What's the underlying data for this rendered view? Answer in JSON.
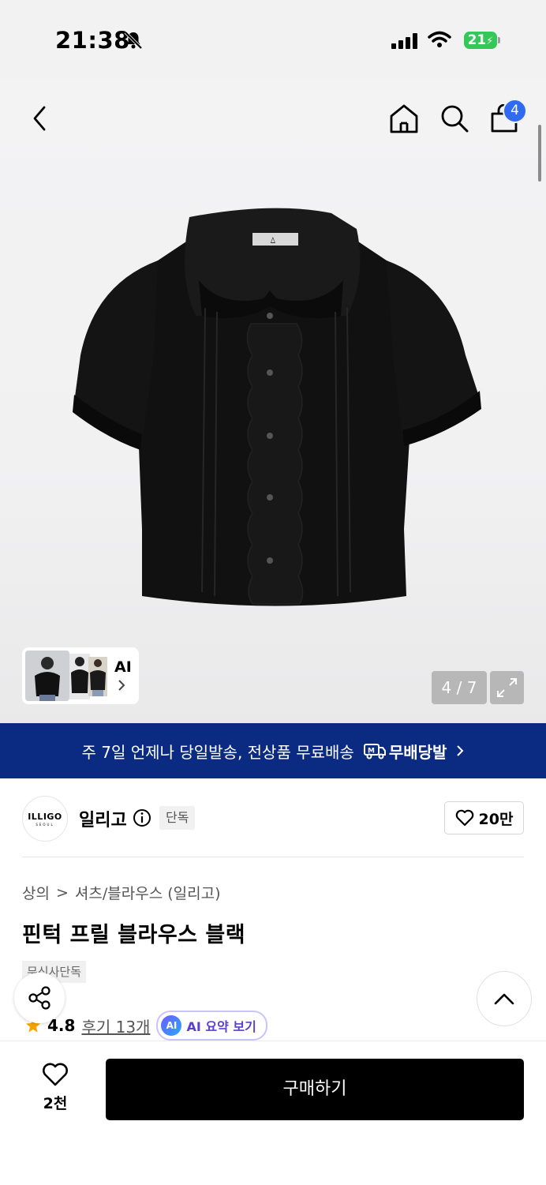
{
  "status_bar": {
    "time": "21:38",
    "battery": "21",
    "icons": [
      "bell-slash-icon",
      "signal-icon",
      "wifi-icon",
      "battery-charging-icon"
    ]
  },
  "nav": {
    "icons": [
      "back-icon",
      "home-icon",
      "search-icon",
      "cart-icon"
    ],
    "cart_count": "4"
  },
  "gallery": {
    "ai_label": "AI",
    "counter": "4 / 7",
    "product_color": "#111111"
  },
  "banner": {
    "text": "주 7일 언제나 당일발송, 전상품 무료배송",
    "badge": "무배당발",
    "badge_icon": "M",
    "bg": "#0b2b82"
  },
  "brand": {
    "logo_text": "ILLIGO",
    "logo_sub": "SEOUL",
    "name": "일리고",
    "exclusive": "단독",
    "likes": "20만"
  },
  "breadcrumb": {
    "category": "상의",
    "separator": ">",
    "subcategory": "셔츠/블라우스 (일리고)"
  },
  "product": {
    "title": "핀턱 프릴 블라우스 블랙",
    "tag": "무신사단독",
    "rating": "4.8",
    "reviews": "후기 13개",
    "ai_summary": "AI 요약 보기",
    "ai_badge": "AI"
  },
  "bottom": {
    "wish_count": "2천",
    "buy_label": "구매하기"
  }
}
